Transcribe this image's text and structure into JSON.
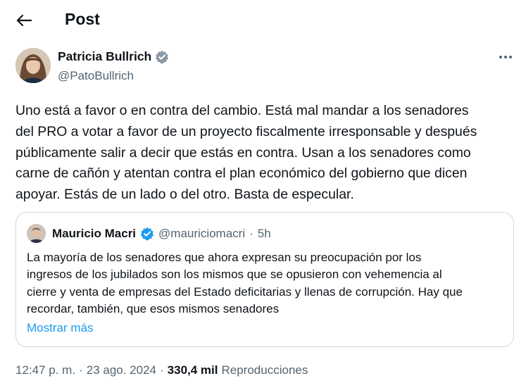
{
  "header": {
    "title": "Post"
  },
  "tweet": {
    "author_name": "Patricia Bullrich",
    "handle": "@PatoBullrich",
    "text_lines": [
      "Uno está a favor o en contra del cambio. Está mal mandar a los senadores",
      "del PRO a votar a favor de un proyecto fiscalmente irresponsable y después",
      "públicamente salir a decir que estás en contra. Usan a los senadores como",
      "carne de cañón y atentan contra el plan económico del gobierno que dicen",
      "apoyar. Estás de un lado o del otro. Basta de especular."
    ]
  },
  "quote": {
    "author_name": "Mauricio Macri",
    "handle": "@mauriciomacri",
    "dot": "·",
    "time": "5h",
    "text_lines": [
      "La mayoría de los senadores que ahora expresan su preocupación por los",
      "ingresos de los jubilados son los mismos que se opusieron con vehemencia al",
      "cierre y venta de empresas del Estado deficitarias y llenas de corrupción. Hay que",
      "recordar, también, que esos mismos senadores"
    ],
    "show_more": "Mostrar más"
  },
  "meta": {
    "time": "12:47 p. m.",
    "sep1": "·",
    "date": "23 ago. 2024",
    "sep2": "·",
    "views_count": "330,4 mil",
    "views_label": "Reproducciones"
  },
  "colors": {
    "verified": "#1d9bf0",
    "link": "#1d9bf0",
    "secondary_text": "#536471",
    "border": "#cfd9de"
  },
  "icons": {
    "back": "arrow-left-icon",
    "verified": "verified-badge-icon",
    "more": "more-dots-icon"
  }
}
